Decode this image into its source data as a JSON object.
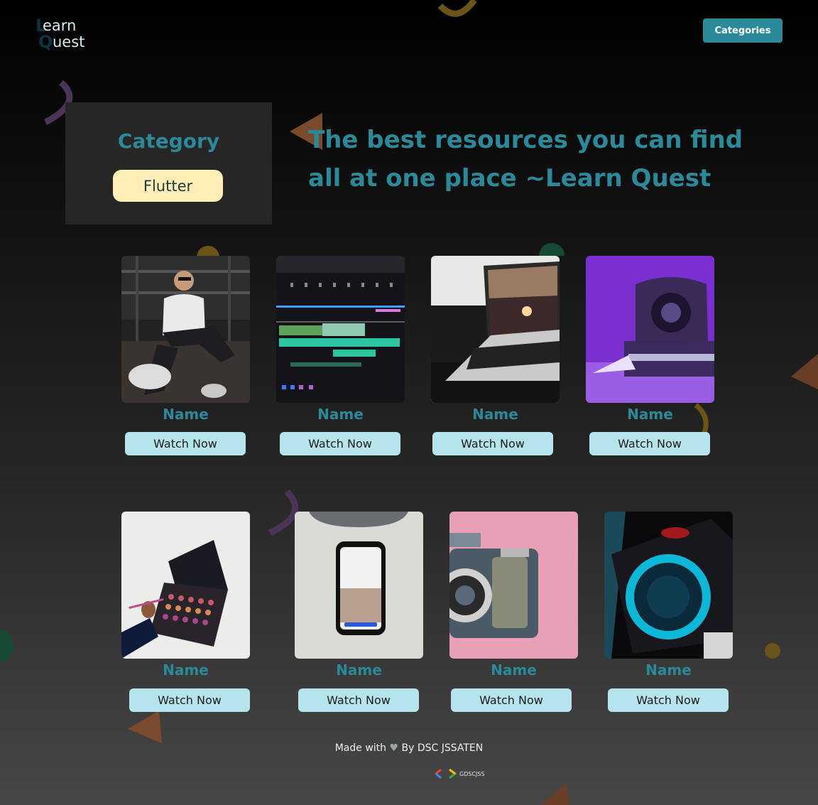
{
  "header": {
    "logo": {
      "letter_l": "L",
      "text_1": "earn",
      "letter_q": "Q",
      "text_2": "uest"
    },
    "categories_button": "Categories"
  },
  "category_panel": {
    "title": "Category",
    "selected": "Flutter"
  },
  "headline": "The best resources you can find all at one place ~Learn Quest",
  "cards": [
    {
      "name": "Name",
      "button": "Watch Now"
    },
    {
      "name": "Name",
      "button": "Watch Now"
    },
    {
      "name": "Name",
      "button": "Watch Now"
    },
    {
      "name": "Name",
      "button": "Watch Now"
    },
    {
      "name": "Name",
      "button": "Watch Now"
    },
    {
      "name": "Name",
      "button": "Watch Now"
    },
    {
      "name": "Name",
      "button": "Watch Now"
    },
    {
      "name": "Name",
      "button": "Watch Now"
    }
  ],
  "footer": {
    "made_with": "Made with",
    "by": "By DSC JSSATEN",
    "badge": "GDSCJSS"
  },
  "colors": {
    "accent": "#2a8a99",
    "pill": "#ffeeb5",
    "button": "#b6e4ec"
  }
}
